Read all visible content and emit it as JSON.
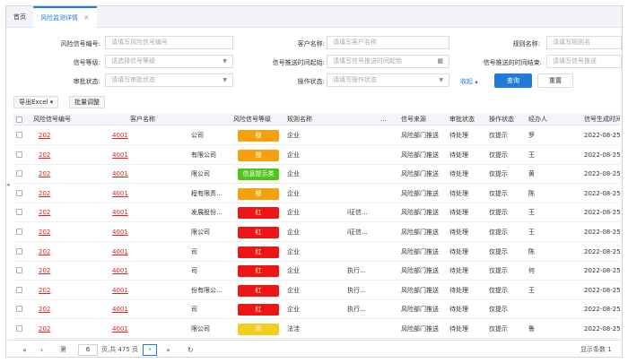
{
  "tabs": [
    {
      "label": "首页"
    },
    {
      "label": "风险监测详情",
      "close": "×"
    }
  ],
  "filters": {
    "signal_no": {
      "label": "风险信号编号:",
      "placeholder": "请填写风险信号编号"
    },
    "customer": {
      "label": "客户名称:",
      "placeholder": "请填写客户名称"
    },
    "rule": {
      "label": "规则名称:",
      "placeholder": "请填写规则名"
    },
    "level": {
      "label": "信号等级:",
      "placeholder": "请选择信号等级"
    },
    "push_start": {
      "label": "信号推送时间起始:",
      "placeholder": "请填写信号推送时间起始"
    },
    "push_end": {
      "label": "信号推送的时间结束:",
      "placeholder": "请填写信号推送"
    },
    "approval": {
      "label": "审批状态:",
      "placeholder": "请填写审批状态"
    },
    "op_status": {
      "label": "操作状态:",
      "placeholder": "请填写操作状态"
    },
    "collapse": "收起",
    "search": "查询",
    "reset": "重置"
  },
  "toolbar": {
    "export": "导出Excel",
    "batch": "批量调整"
  },
  "columns": [
    "风险信号编号",
    "客户名称",
    "风险信号等级",
    "规则名称",
    "...",
    "信号来源",
    "审批状态",
    "操作状态",
    "经办人",
    "信号生成时间"
  ],
  "colors": {
    "orange": "#f5a10f",
    "green": "#52c41a",
    "red": "#f01414",
    "yellow": "#f6cc1d",
    "accent": "#1f7ad8"
  },
  "rows": [
    {
      "id_a": "202",
      "id_b": "4001",
      "customer": "公司",
      "level": "橙",
      "level_color": "#f5a10f",
      "rule": "企业",
      "extra": "",
      "source": "风险部门推送",
      "approval": "待处理",
      "op": "仅提示",
      "handler": "罗",
      "time": "2022-08-25"
    },
    {
      "id_a": "202",
      "id_b": "4001",
      "customer": "有限公司",
      "level": "橙",
      "level_color": "#f5a10f",
      "rule": "企业",
      "extra": "",
      "source": "风险部门推送",
      "approval": "待处理",
      "op": "仅提示",
      "handler": "王",
      "time": "2022-08-25"
    },
    {
      "id_a": "202",
      "id_b": "4001",
      "customer": "限公司",
      "level": "信息提示类",
      "level_color": "#52c41a",
      "rule": "企业",
      "extra": "",
      "source": "风险部门推送",
      "approval": "待处理",
      "op": "仅提示",
      "handler": "黄",
      "time": "2022-08-25"
    },
    {
      "id_a": "202",
      "id_b": "4001",
      "customer": "程有限责...",
      "level": "橙",
      "level_color": "#f5a10f",
      "rule": "企业",
      "extra": "",
      "source": "风险部门推送",
      "approval": "待处理",
      "op": "仅提示",
      "handler": "陈",
      "time": "2022-08-25"
    },
    {
      "id_a": "202",
      "id_b": "4001",
      "customer": "发展股份...",
      "level": "红",
      "level_color": "#f01414",
      "rule": "企业",
      "extra": "i征信...",
      "source": "风险部门推送",
      "approval": "待处理",
      "op": "仅提示",
      "handler": "王",
      "time": "2022-08-25"
    },
    {
      "id_a": "202",
      "id_b": "4001",
      "customer": "限公司",
      "level": "红",
      "level_color": "#f01414",
      "rule": "企业",
      "extra": "i征信...",
      "source": "风险部门推送",
      "approval": "待处理",
      "op": "仅提示",
      "handler": "王",
      "time": "2022-08-25"
    },
    {
      "id_a": "202",
      "id_b": "4001",
      "customer": "司",
      "level": "红",
      "level_color": "#f01414",
      "rule": "企业",
      "extra": "",
      "source": "风险部门推送",
      "approval": "待处理",
      "op": "仅提示",
      "handler": "陈",
      "time": "2022-08-25"
    },
    {
      "id_a": "202",
      "id_b": "4001",
      "customer": "司",
      "level": "红",
      "level_color": "#f01414",
      "rule": "企业",
      "extra": "执行...",
      "source": "风险部门推送",
      "approval": "待处理",
      "op": "仅提示",
      "handler": "何",
      "time": "2022-08-25"
    },
    {
      "id_a": "202",
      "id_b": "4001",
      "customer": "份有限公...",
      "level": "红",
      "level_color": "#f01414",
      "rule": "企业",
      "extra": "执行...",
      "source": "风险部门推送",
      "approval": "待处理",
      "op": "仅提示",
      "handler": "王",
      "time": "2022-08-25"
    },
    {
      "id_a": "202",
      "id_b": "4001",
      "customer": "司",
      "level": "红",
      "level_color": "#f01414",
      "rule": "企业",
      "extra": "执行...",
      "source": "风险部门推送",
      "approval": "待处理",
      "op": "仅提示",
      "handler": "",
      "time": "2022-08-25"
    },
    {
      "id_a": "202",
      "id_b": "4001",
      "customer": "限公司",
      "level": "黄",
      "level_color": "#f6cc1d",
      "rule": "法洼",
      "extra": "",
      "source": "风险部门推送",
      "approval": "待处理",
      "op": "仅提示",
      "handler": "鲁",
      "time": "2022-08-25"
    }
  ],
  "pagination": {
    "first": "«",
    "prev": "‹",
    "page_prefix": "第",
    "page": "6",
    "page_suffix": "页,共 475 页",
    "next": "›",
    "last": "»",
    "refresh": "↻",
    "display": "显示条数 1"
  }
}
